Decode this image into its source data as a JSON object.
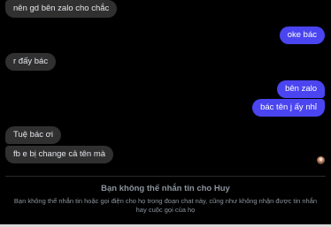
{
  "messages": [
    {
      "text": "nên gd bên zalo cho chắc",
      "from": "incoming"
    },
    {
      "text": "oke bác",
      "from": "outgoing"
    },
    {
      "text": "r đấy bác",
      "from": "incoming"
    },
    {
      "text": "bên zalo",
      "from": "outgoing"
    },
    {
      "text": "bác tên j ấy nhỉ",
      "from": "outgoing"
    },
    {
      "text": "Tuệ bác ơi",
      "from": "incoming"
    },
    {
      "text": "fb e bị change cả tên mà",
      "from": "incoming"
    }
  ],
  "notice": {
    "title": "Bạn không thể nhắn tin cho Huy",
    "body": "Bạn không thể nhắn tin hoặc gọi điện cho họ trong đoạn chat này, cũng như không nhận được tin nhắn hay cuộc gọi của họ"
  },
  "colors": {
    "background": "#000000",
    "incoming_bubble": "#303030",
    "outgoing_bubble": "#4a45f0",
    "notice_text": "#8d949e"
  },
  "icons": {
    "seen_indicator": "avatar-seen-icon"
  }
}
